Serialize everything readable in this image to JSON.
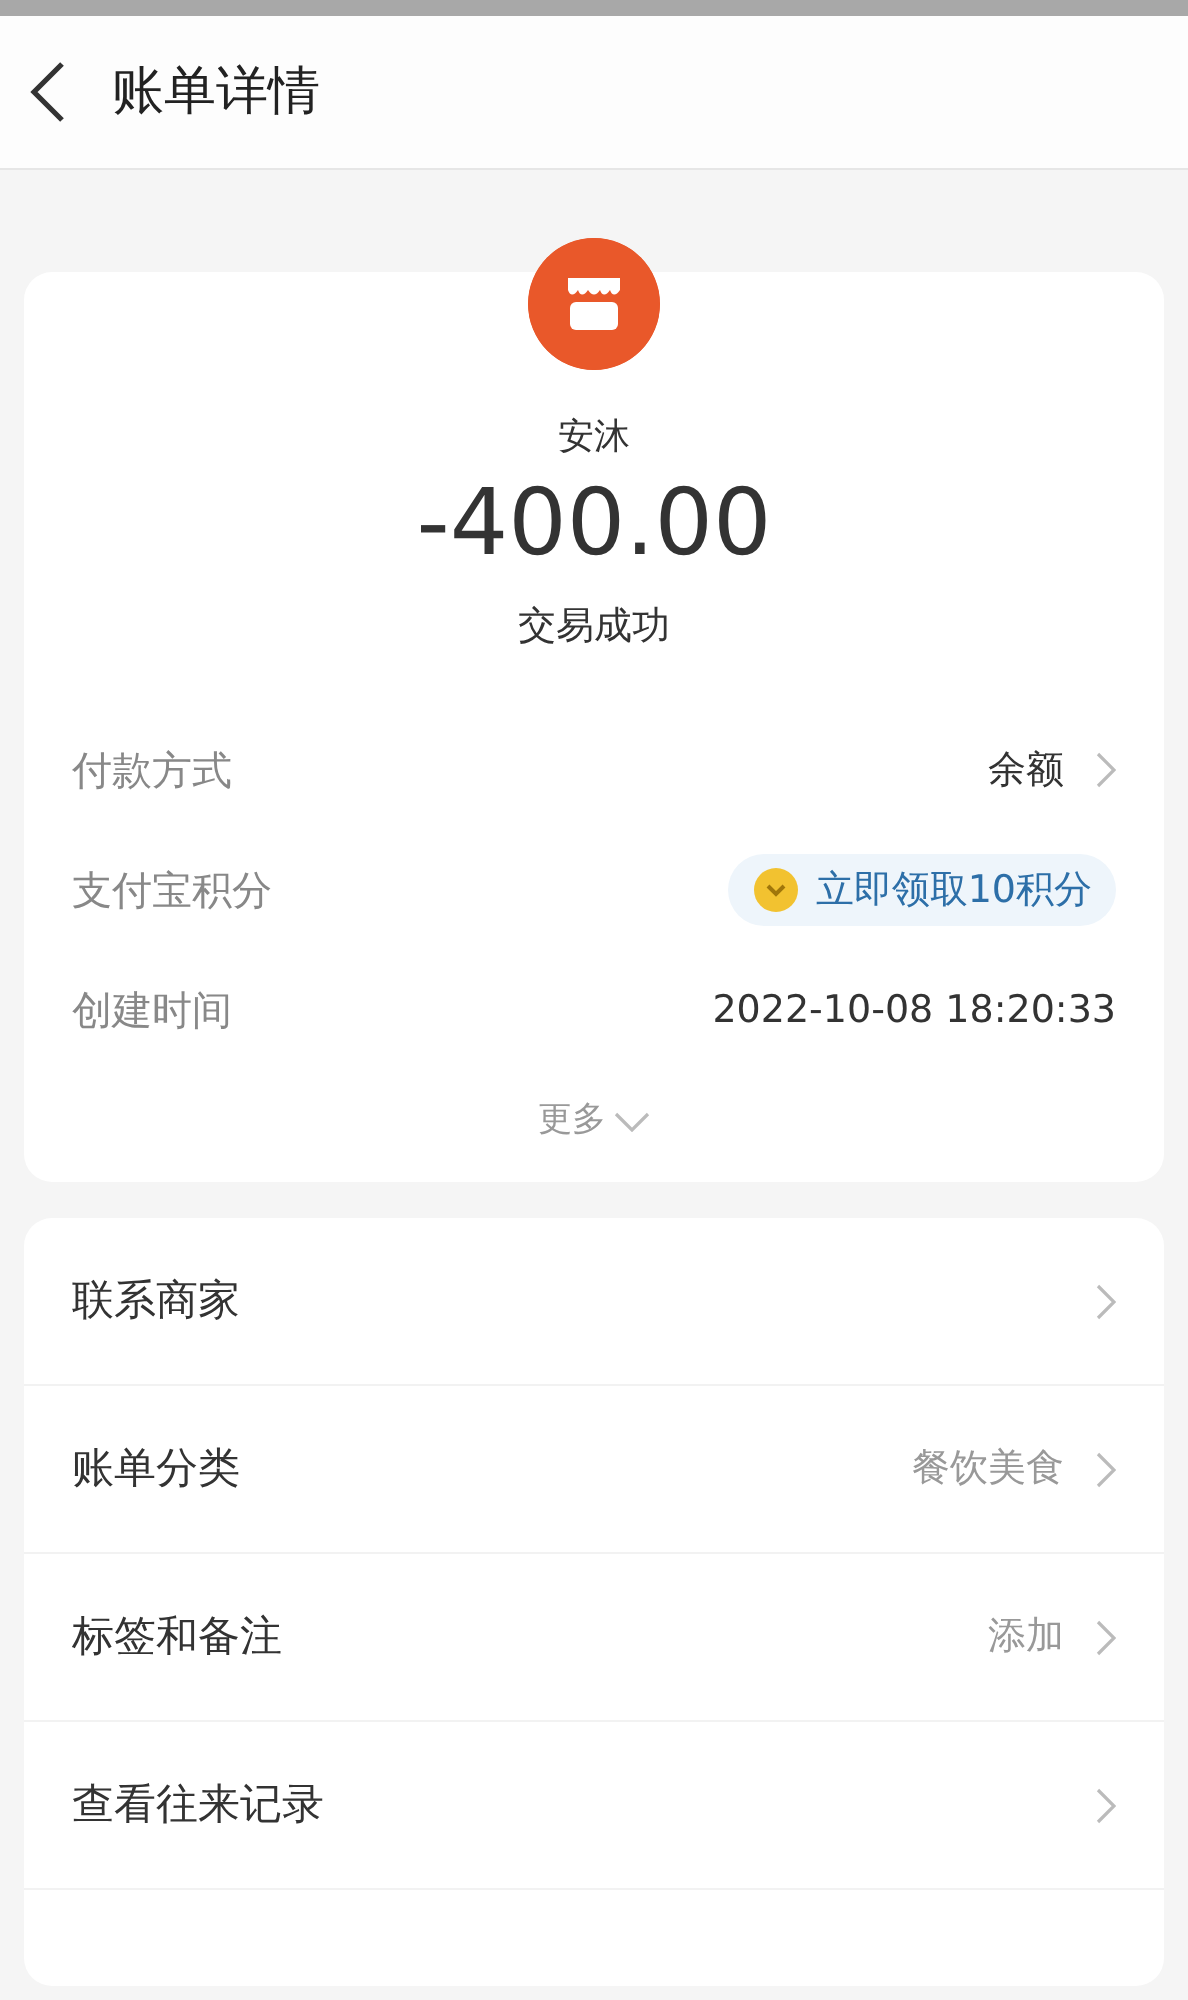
{
  "header": {
    "title": "账单详情"
  },
  "summary": {
    "merchant": "安沐",
    "amount": "-400.00",
    "status": "交易成功"
  },
  "details": [
    {
      "kind": "link",
      "label": "付款方式",
      "value": "余额"
    },
    {
      "kind": "badge",
      "label": "支付宝积分",
      "value": "立即领取10积分"
    },
    {
      "kind": "plain",
      "label": "创建时间",
      "value": "2022-10-08 18:20:33"
    }
  ],
  "more": "更多",
  "actions": [
    {
      "label": "联系商家"
    },
    {
      "label": "账单分类",
      "value": "餐饮美食"
    },
    {
      "label": "标签和备注",
      "value": "添加"
    },
    {
      "label": "查看往来记录"
    }
  ]
}
